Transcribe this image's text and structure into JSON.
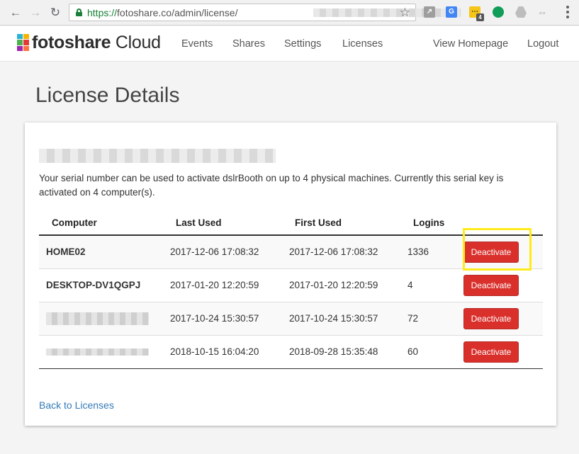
{
  "browser": {
    "url_protocol": "https://",
    "url_domain": "fotoshare.co",
    "url_path": "/admin/license/",
    "extension_badge": "4"
  },
  "header": {
    "logo_bold": "fotoshare",
    "logo_light": " Cloud",
    "nav": [
      "Events",
      "Shares",
      "Settings",
      "Licenses"
    ],
    "view_homepage": "View Homepage",
    "logout": "Logout"
  },
  "page": {
    "title": "License Details",
    "description": "Your serial number can be used to activate dslrBooth on up to 4 physical machines. Currently this serial key is activated on 4 computer(s).",
    "back_link": "Back to Licenses"
  },
  "table": {
    "headers": [
      "Computer",
      "Last Used",
      "First Used",
      "Logins"
    ],
    "rows": [
      {
        "computer": "HOME02",
        "last_used": "2017-12-06 17:08:32",
        "first_used": "2017-12-06 17:08:32",
        "logins": "1336",
        "action": "Deactivate"
      },
      {
        "computer": "DESKTOP-DV1QGPJ",
        "last_used": "2017-01-20 12:20:59",
        "first_used": "2017-01-20 12:20:59",
        "logins": "4",
        "action": "Deactivate"
      },
      {
        "computer": "",
        "last_used": "2017-10-24 15:30:57",
        "first_used": "2017-10-24 15:30:57",
        "logins": "72",
        "action": "Deactivate"
      },
      {
        "computer": "",
        "last_used": "2018-10-15 16:04:20",
        "first_used": "2018-09-28 15:35:48",
        "logins": "60",
        "action": "Deactivate"
      }
    ]
  },
  "colors": {
    "deactivate": "#d9302c",
    "highlight": "#ffeb1a",
    "link": "#337ab7"
  }
}
